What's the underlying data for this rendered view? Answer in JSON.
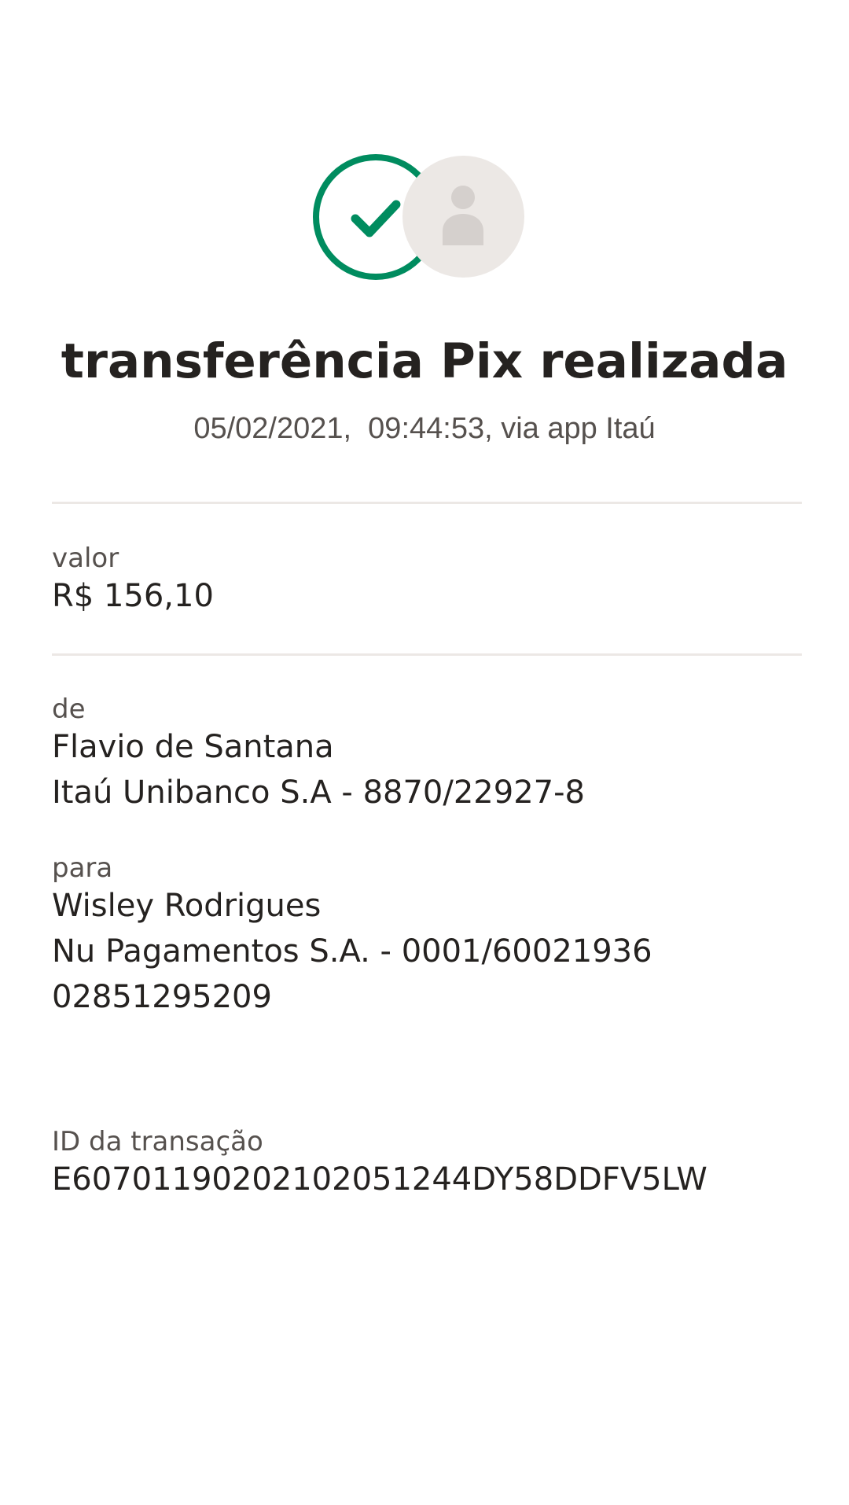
{
  "header": {
    "status_icon": "check-circle-icon",
    "recipient_icon": "user-avatar-icon",
    "title": "transferência Pix realizada",
    "subtitle": "05/02/2021,  09:44:53, via app Itaú"
  },
  "colors": {
    "success": "#008c5f",
    "avatar_bg": "#ece8e5",
    "avatar_icon": "#d5d0cd",
    "text_primary": "#252220",
    "text_secondary": "#56514e"
  },
  "amount": {
    "label": "valor",
    "value": "R$ 156,10"
  },
  "from": {
    "label": "de",
    "name": "Flavio de Santana",
    "bank": "Itaú Unibanco S.A - 8870/22927-8"
  },
  "to": {
    "label": "para",
    "name": "Wisley Rodrigues",
    "bank": "Nu Pagamentos S.A. - 0001/60021936",
    "key": "02851295209"
  },
  "transaction": {
    "label": "ID da transação",
    "id": "E60701190202102051244DY58DDFV5LW"
  }
}
